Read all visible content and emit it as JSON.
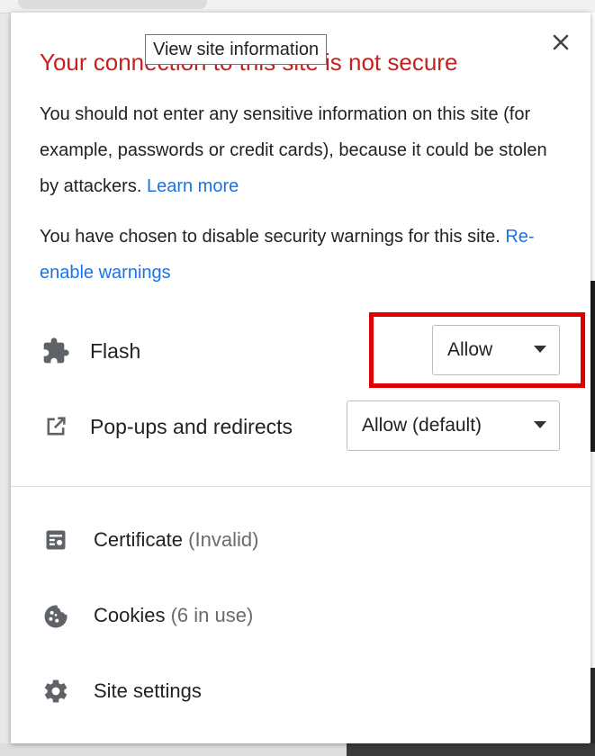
{
  "popup": {
    "title": "Your connection to this site is not secure",
    "tooltip": "View site information",
    "warning_text": "You should not enter any sensitive information on this site (for example, passwords or credit cards), because it could be stolen by attackers.",
    "learn_more": "Learn more",
    "disabled_text": "You have chosen to disable security warnings for this site.",
    "reenable_link": "Re-enable warnings"
  },
  "permissions": [
    {
      "label": "Flash",
      "value": "Allow",
      "icon": "puzzle-icon"
    },
    {
      "label": "Pop-ups and redirects",
      "value": "Allow (default)",
      "icon": "external-link-icon"
    }
  ],
  "menu": [
    {
      "label": "Certificate",
      "detail": "(Invalid)",
      "icon": "certificate-icon"
    },
    {
      "label": "Cookies",
      "detail": "(6 in use)",
      "icon": "cookie-icon"
    },
    {
      "label": "Site settings",
      "detail": "",
      "icon": "gear-icon"
    }
  ],
  "colors": {
    "title": "#c5221f",
    "link": "#1a73e8",
    "highlight": "#e00000",
    "icon": "#5f6368"
  }
}
